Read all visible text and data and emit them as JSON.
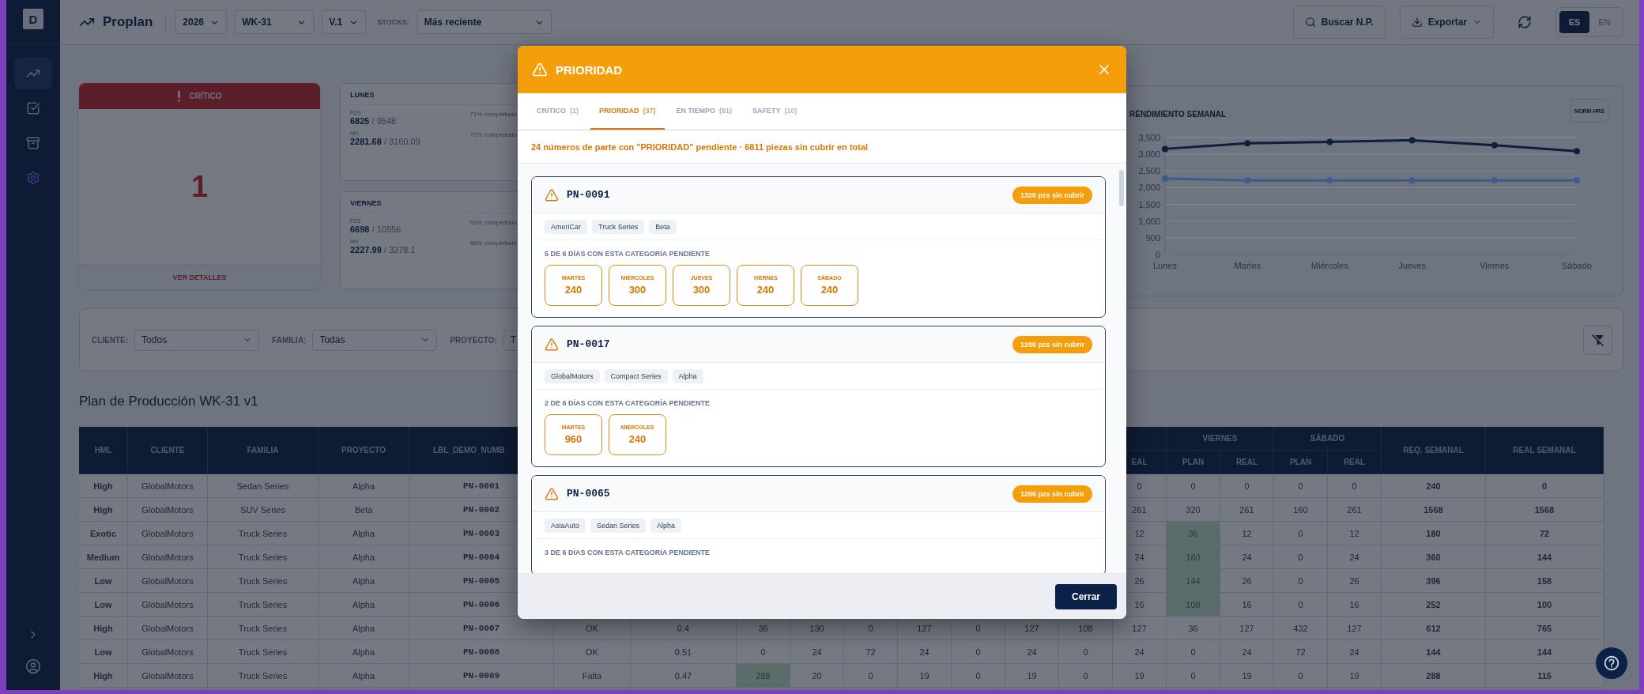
{
  "sidebar": {
    "logo": "D",
    "items": [
      {
        "kind": "trend",
        "selected": true
      },
      {
        "kind": "checklist",
        "selected": false
      },
      {
        "kind": "archive",
        "selected": false
      },
      {
        "kind": "settings",
        "selected": false
      }
    ]
  },
  "topbar": {
    "app_name": "Proplan",
    "year": "2026",
    "week": "WK-31",
    "version": "V.1",
    "stocks_label": "STOCKS:",
    "stocks_value": "Más reciente",
    "search_button": "Buscar N.P.",
    "export_button": "Exportar",
    "languages": [
      {
        "label": "ES",
        "selected": true
      },
      {
        "label": "EN",
        "selected": false
      }
    ]
  },
  "critical_card": {
    "title": "CRÍTICO",
    "count": "1",
    "link": "VER DETALLES"
  },
  "day_cards": [
    {
      "day": "LUNES",
      "rows": [
        {
          "label": "PZS",
          "figure": "**6825** / 9548",
          "progress": "71% completado"
        },
        {
          "label": "NH",
          "figure": "**2281.68** / 3160.09",
          "progress": "72% completado"
        }
      ]
    },
    {
      "day": "VIERNES",
      "rows": [
        {
          "label": "PZS",
          "figure": "**6698** / 10556",
          "progress": "63% completado"
        },
        {
          "label": "NH",
          "figure": "**2227.99** / 3278.1",
          "progress": "68% completado"
        }
      ]
    }
  ],
  "performance_chart": {
    "title": "RENDIMIENTO SEMANAL",
    "toggle": "NORM HRS",
    "chart_data": {
      "type": "line",
      "categories": [
        "Lunes",
        "Martes",
        "Miércoles",
        "Jueves",
        "Viernes",
        "Sábado"
      ],
      "series": [
        {
          "color": "#0f1f3d",
          "marker": true,
          "values": [
            3160,
            3330,
            3370,
            3420,
            3270,
            3090
          ]
        },
        {
          "color": "#3f5a8f",
          "marker": true,
          "values": [
            2270,
            2220,
            2220,
            2220,
            2220,
            2220
          ]
        }
      ],
      "grid": true,
      "ylim": [
        0,
        3500
      ],
      "yticks": [
        {
          "value": 0,
          "label": "0"
        },
        {
          "value": 500,
          "label": "500"
        },
        {
          "value": 1000,
          "label": "1,000"
        },
        {
          "value": 1500,
          "label": "1,500"
        },
        {
          "value": 2000,
          "label": "2,000"
        },
        {
          "value": 2500,
          "label": "2,500"
        },
        {
          "value": 3000,
          "label": "3,000"
        },
        {
          "value": 3500,
          "label": "3,500"
        }
      ]
    }
  },
  "filters": [
    {
      "label": "CLIENTE:",
      "value": "Todos",
      "chevron": true
    },
    {
      "label": "FAMILIA:",
      "value": "Todas",
      "chevron": true
    },
    {
      "label": "PROYECTO:",
      "value": "T"
    }
  ],
  "table": {
    "title": "Plan de Producción WK-31 v1",
    "left_columns": [
      "HML",
      "CLIENTE",
      "FAMILIA",
      "PROYECTO",
      "LBL_DEMO_NUMB"
    ],
    "right_partial_column": "EAL",
    "right_groups": [
      {
        "label": "VIERNES",
        "columns": [
          "PLAN",
          "REAL"
        ]
      },
      {
        "label": "SÁBADO",
        "columns": [
          "PLAN",
          "REAL"
        ]
      }
    ],
    "total_columns": [
      "REQ. SEMANAL",
      "REAL SEMANAL"
    ],
    "rows": [
      {
        "cells": [
          "High",
          "GlobalMotors",
          "Sedan Series",
          "Alpha",
          "PN-0001",
          null,
          null,
          null,
          null,
          null,
          null,
          null,
          null,
          null,
          "0",
          "0",
          "0",
          "0",
          "0",
          "240",
          "0"
        ]
      },
      {
        "cells": [
          "High",
          "GlobalMotors",
          "SUV Series",
          "Beta",
          "PN-0002",
          null,
          null,
          null,
          null,
          null,
          null,
          null,
          null,
          null,
          "261",
          "320",
          "261",
          "160",
          "261",
          "1568",
          "1568"
        ]
      },
      {
        "cells": [
          "Exotic",
          "GlobalMotors",
          "Truck Series",
          "Alpha",
          "PN-0003",
          null,
          null,
          null,
          null,
          null,
          null,
          null,
          null,
          null,
          "12",
          {
            "text": "36",
            "highlighted": true
          },
          "12",
          "0",
          "12",
          "180",
          "72"
        ]
      },
      {
        "cells": [
          "Medium",
          "GlobalMotors",
          "Truck Series",
          "Alpha",
          "PN-0004",
          null,
          null,
          null,
          null,
          null,
          null,
          null,
          null,
          null,
          "24",
          {
            "text": "180",
            "highlighted": true
          },
          "24",
          "0",
          "24",
          "360",
          "144"
        ]
      },
      {
        "cells": [
          "Low",
          "GlobalMotors",
          "Truck Series",
          "Alpha",
          "PN-0005",
          null,
          null,
          null,
          null,
          null,
          null,
          null,
          null,
          null,
          "26",
          {
            "text": "144",
            "highlighted": true
          },
          "26",
          "0",
          "26",
          "396",
          "158"
        ]
      },
      {
        "cells": [
          "Low",
          "GlobalMotors",
          "Truck Series",
          "Alpha",
          "PN-0006",
          null,
          null,
          null,
          null,
          null,
          null,
          null,
          null,
          null,
          "16",
          {
            "text": "108",
            "highlighted": true
          },
          "16",
          "0",
          "16",
          "252",
          "100"
        ]
      },
      {
        "cells": [
          "High",
          "GlobalMotors",
          "Truck Series",
          "Alpha",
          "PN-0007",
          "OK",
          "0.4",
          "36",
          "130",
          "0",
          "127",
          "0",
          "127",
          "108",
          "127",
          "36",
          "127",
          "432",
          "127",
          "612",
          "765"
        ]
      },
      {
        "cells": [
          "Low",
          "GlobalMotors",
          "Truck Series",
          "Alpha",
          "PN-0008",
          "OK",
          "0.51",
          "0",
          "24",
          "72",
          "24",
          "0",
          "24",
          "0",
          "24",
          "0",
          "24",
          "72",
          "24",
          "144",
          "144"
        ]
      },
      {
        "cells": [
          "High",
          "GlobalMotors",
          "Truck Series",
          "Alpha",
          "PN-0009",
          "Falta",
          "0.47",
          {
            "text": "288",
            "highlighted": true
          },
          "20",
          "0",
          "19",
          "0",
          "19",
          "0",
          "19",
          "0",
          "19",
          "0",
          "19",
          "288",
          "115"
        ]
      }
    ]
  },
  "modal": {
    "title": "PRIORIDAD",
    "tabs": [
      {
        "label": "CRÍTICO",
        "count": "(1)",
        "selected": false
      },
      {
        "label": "PRIORIDAD",
        "count": "(37)",
        "selected": true
      },
      {
        "label": "EN TIEMPO",
        "count": "(81)",
        "selected": false
      },
      {
        "label": "SAFETY",
        "count": "(10)",
        "selected": false
      }
    ],
    "summary": "24 números de parte con \"PRIORIDAD\" pendiente · 6811 piezas sin cubrir en total",
    "parts": [
      {
        "part": "PN-0091",
        "badge": "1320 pzs sin cubrir",
        "tags": [
          "AmeriCar",
          "Truck Series",
          "Beta"
        ],
        "days_label": "5 DE 6 DÍAS CON ESTA CATEGORÍA PENDIENTE",
        "days": [
          {
            "day": "MARTES",
            "qty": "240"
          },
          {
            "day": "MIÉRCOLES",
            "qty": "300"
          },
          {
            "day": "JUEVES",
            "qty": "300"
          },
          {
            "day": "VIERNES",
            "qty": "240"
          },
          {
            "day": "SÁBADO",
            "qty": "240"
          }
        ]
      },
      {
        "part": "PN-0017",
        "badge": "1200 pzs sin cubrir",
        "tags": [
          "GlobalMotors",
          "Compact Series",
          "Alpha"
        ],
        "days_label": "2 DE 6 DÍAS CON ESTA CATEGORÍA PENDIENTE",
        "days": [
          {
            "day": "MARTES",
            "qty": "960"
          },
          {
            "day": "MIÉRCOLES",
            "qty": "240"
          }
        ]
      },
      {
        "part": "PN-0065",
        "badge": "1200 pzs sin cubrir",
        "tags": [
          "AsiaAuto",
          "Sedan Series",
          "Alpha"
        ],
        "days_label": "3 DE 6 DÍAS CON ESTA CATEGORÍA PENDIENTE"
      }
    ],
    "close_button": "Cerrar"
  }
}
